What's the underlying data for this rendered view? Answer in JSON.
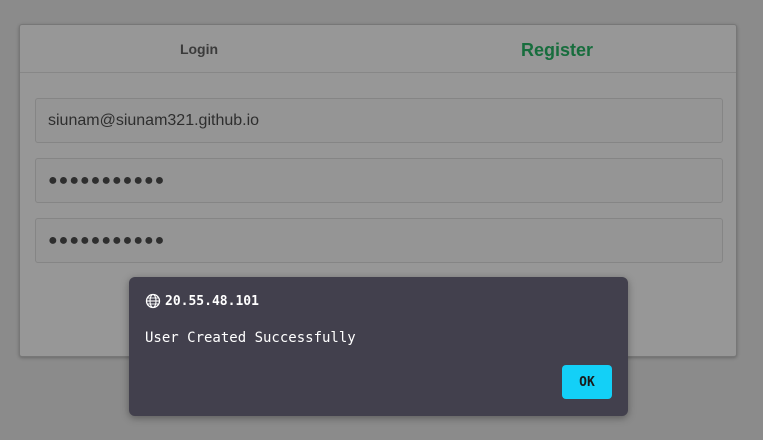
{
  "tabs": {
    "login_label": "Login",
    "register_label": "Register"
  },
  "form": {
    "email_value": "siunam@siunam321.github.io",
    "password_mask": "●●●●●●●●●●●",
    "confirm_password_mask": "●●●●●●●●●●●"
  },
  "dialog": {
    "origin": "20.55.48.101",
    "message": "User Created Successfully",
    "ok_label": "OK",
    "icon": "globe-icon"
  },
  "colors": {
    "register_tab": "#176d3d",
    "dialog_bg": "#42404d",
    "ok_button": "#13d0f7"
  }
}
